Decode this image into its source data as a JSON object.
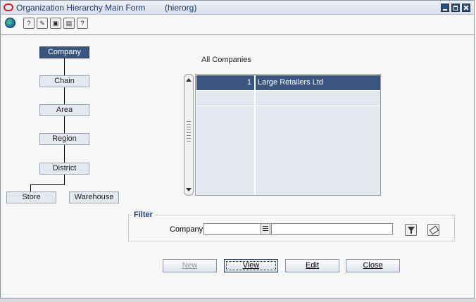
{
  "window": {
    "title": "Organization Hierarchy Main Form",
    "code": "(hierorg)"
  },
  "toolbar": {
    "buttons": [
      "globe-icon",
      "help-icon",
      "query-icon",
      "save-icon",
      "print-icon",
      "help-question-icon"
    ]
  },
  "hierarchy": {
    "nodes": [
      "Company",
      "Chain",
      "Area",
      "Region",
      "District",
      "Store",
      "Warehouse"
    ],
    "selected": "Company"
  },
  "grid": {
    "label": "All Companies",
    "rows": [
      {
        "num": "1",
        "name": "Large Retailers Ltd"
      },
      {
        "num": "",
        "name": ""
      },
      {
        "num": "",
        "name": ""
      },
      {
        "num": "",
        "name": ""
      },
      {
        "num": "",
        "name": ""
      },
      {
        "num": "",
        "name": ""
      },
      {
        "num": "",
        "name": ""
      },
      {
        "num": "",
        "name": ""
      }
    ]
  },
  "filter": {
    "title": "Filter",
    "company_label": "Company",
    "company_value": "",
    "company_description": ""
  },
  "actions": {
    "new_label": "New",
    "view_label": "View",
    "edit_label": "Edit",
    "close_label": "Close"
  },
  "colors": {
    "selected_bg": "#3a567e",
    "title_text": "#1a3b6e",
    "oracle_red": "#d21f1f"
  }
}
